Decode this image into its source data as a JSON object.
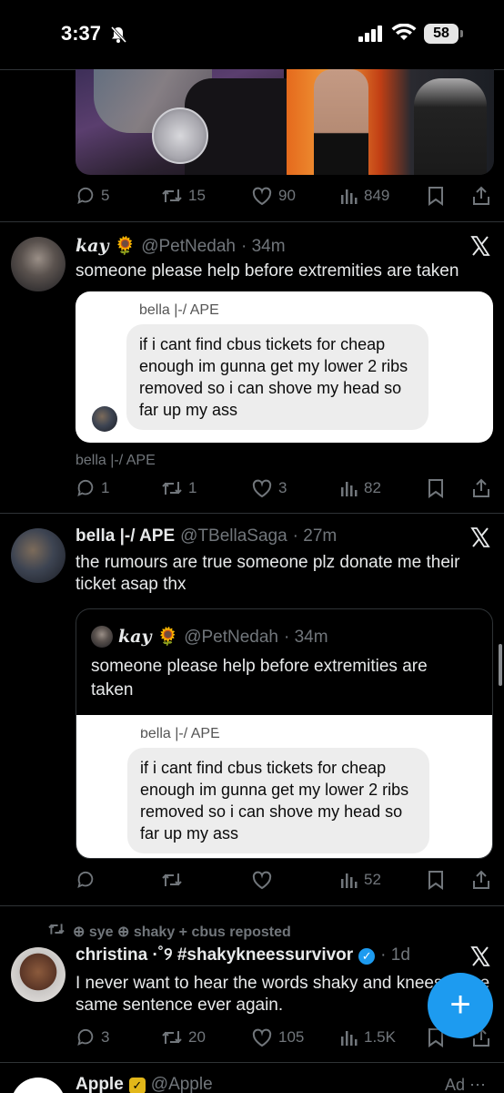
{
  "status_bar": {
    "time": "3:37",
    "battery": "58"
  },
  "tweets": [
    {
      "id": "prev",
      "actions": {
        "replies": "5",
        "reposts": "15",
        "likes": "90",
        "views": "849"
      }
    },
    {
      "id": "kay",
      "name": "𝒌𝒂𝒚",
      "emoji": "🌻",
      "handle": "@PetNedah",
      "time": "· 34m",
      "text": "someone please help before extremities are taken",
      "card": {
        "name": "bella |-/ APE",
        "message": "if i cant find cbus tickets for cheap enough im gunna get my lower 2 ribs removed so i can shove my head so far up my ass"
      },
      "alt_label": "bella |-/ APE",
      "actions": {
        "replies": "1",
        "reposts": "1",
        "likes": "3",
        "views": "82"
      }
    },
    {
      "id": "bella",
      "name": "bella |-/ APE",
      "handle": "@TBellaSaga",
      "time": "· 27m",
      "text": "the rumours are true someone plz donate me their ticket asap thx",
      "quote": {
        "name": "𝒌𝒂𝒚",
        "emoji": "🌻",
        "handle": "@PetNedah",
        "time": "· 34m",
        "text": "someone please help before extremities are taken",
        "card": {
          "name": "bella |-/ APE",
          "message": "if i cant find cbus tickets for cheap enough im gunna get my lower 2 ribs removed so i can shove my head so far up my ass"
        }
      },
      "actions": {
        "replies": "",
        "reposts": "",
        "likes": "",
        "views": "52"
      }
    },
    {
      "id": "christina",
      "repost_by": "⊕ sye ⊕ shaky + cbus reposted",
      "name": "christina ·˚୨ #shakykneessurvivor",
      "time": "· 1d",
      "text": "I never want to hear the words shaky and knees in the same sentence ever again.",
      "actions": {
        "replies": "3",
        "reposts": "20",
        "likes": "105",
        "views": "1.5K"
      }
    },
    {
      "id": "apple",
      "name": "Apple",
      "handle": "@Apple",
      "ad": "Ad"
    }
  ],
  "fab": {
    "label": "+"
  }
}
